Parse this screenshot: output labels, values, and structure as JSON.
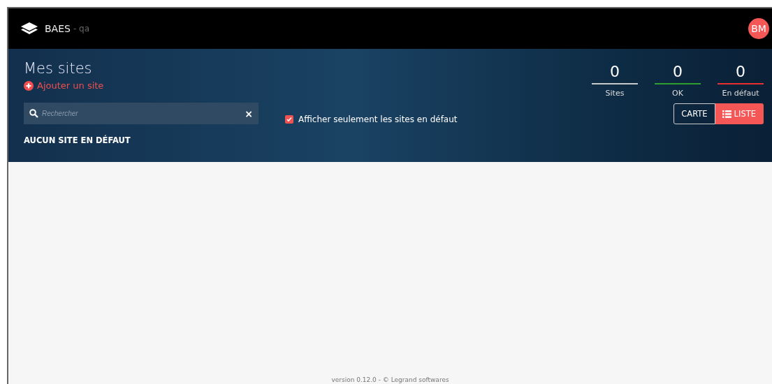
{
  "app": {
    "name": "BAES",
    "environment": "- qa",
    "avatar": "BM"
  },
  "header": {
    "title": "Mes sites",
    "add_link": "Ajouter un site"
  },
  "search": {
    "placeholder": "Rechercher",
    "clear": "×"
  },
  "filter": {
    "label": "Afficher seulement les sites en défaut",
    "checked": true
  },
  "status_text": "AUCUN SITE EN DÉFAUT",
  "stats": [
    {
      "value": "0",
      "label": "Sites",
      "color": "#c8c8c8"
    },
    {
      "value": "0",
      "label": "OK",
      "color": "#2e9e2e"
    },
    {
      "value": "0",
      "label": "En défaut",
      "color": "#e8312f"
    }
  ],
  "view_toggle": [
    {
      "label": "CARTE",
      "kind": "map",
      "selected": false
    },
    {
      "label": "LISTE",
      "kind": "list",
      "selected": true
    }
  ],
  "footer": "version 0.12.0 - © Legrand softwares"
}
